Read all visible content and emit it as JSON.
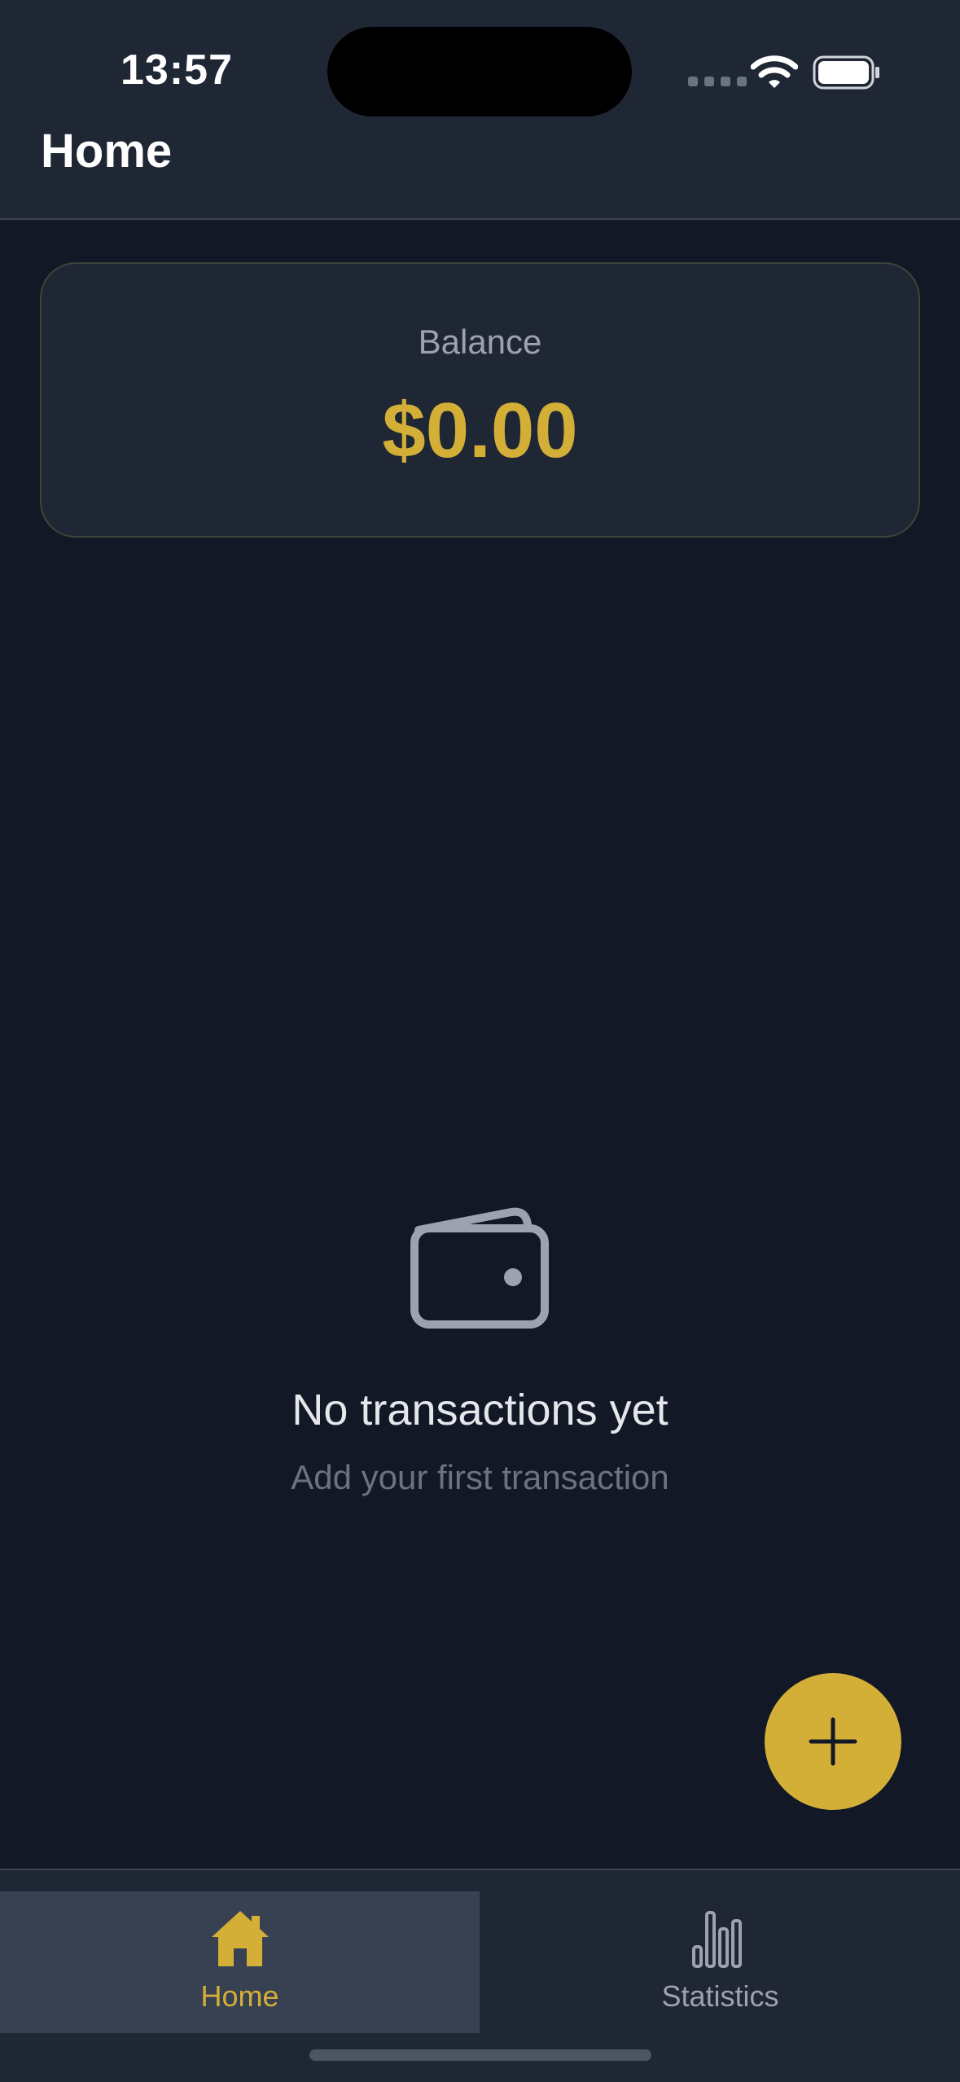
{
  "status_bar": {
    "time": "13:57",
    "icons": [
      "signal-dots-icon",
      "wifi-icon",
      "battery-icon"
    ]
  },
  "header": {
    "title": "Home"
  },
  "balance": {
    "label": "Balance",
    "amount": "$0.00"
  },
  "empty_state": {
    "icon": "wallet-icon",
    "title": "No transactions yet",
    "subtitle": "Add your first transaction"
  },
  "fab": {
    "icon": "plus-icon"
  },
  "tabs": [
    {
      "label": "Home",
      "icon": "house-icon",
      "active": true
    },
    {
      "label": "Statistics",
      "icon": "bar-chart-icon",
      "active": false
    }
  ],
  "colors": {
    "background": "#121826",
    "surface": "#1f2735",
    "accent": "#d4af37",
    "muted_text": "#9ca3af"
  }
}
